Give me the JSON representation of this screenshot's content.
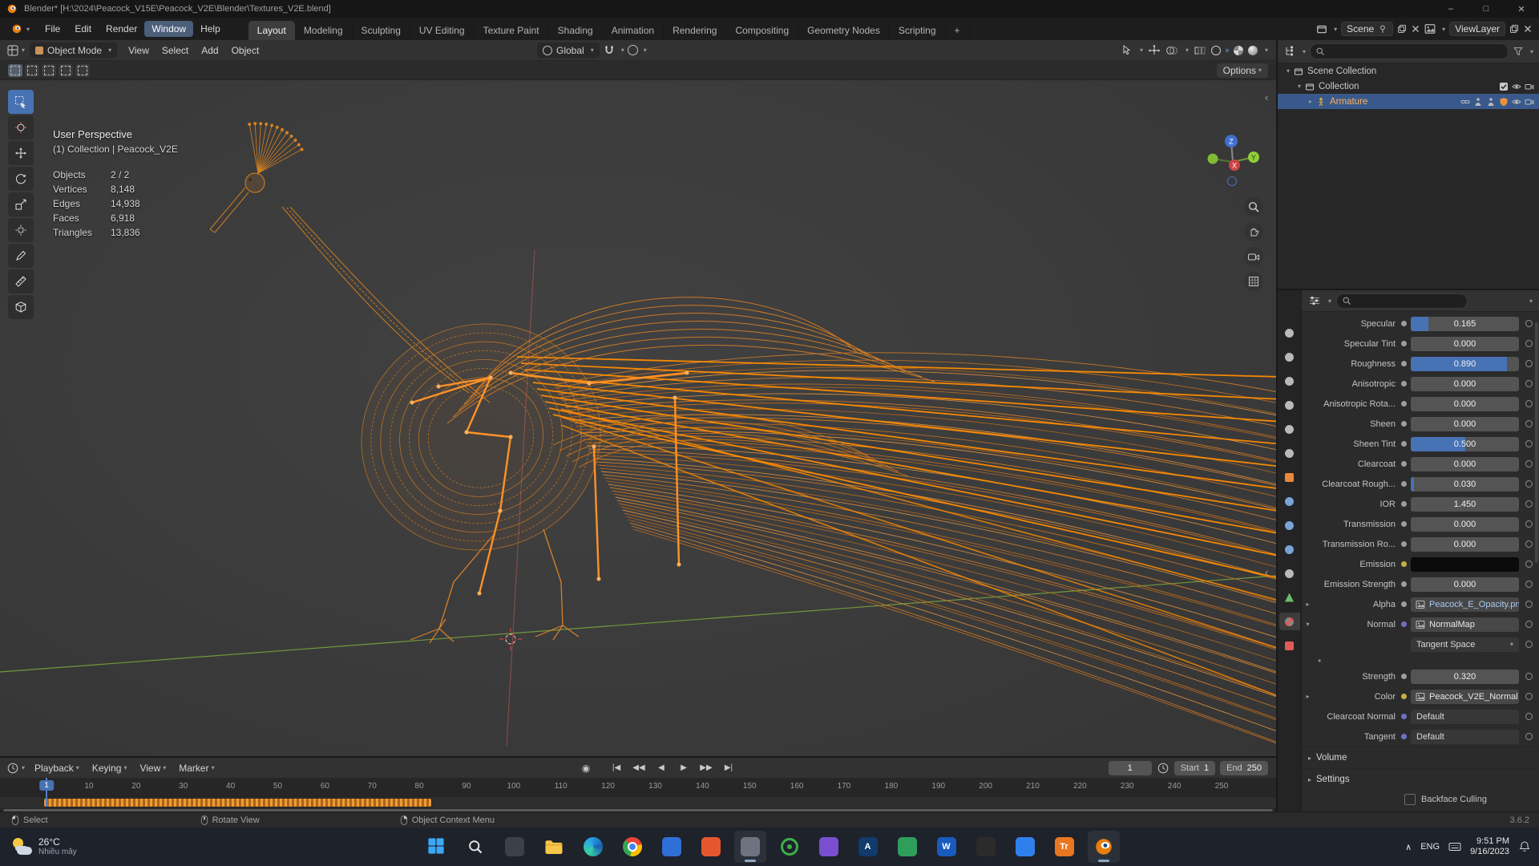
{
  "titlebar": {
    "title": "Blender* [H:\\2024\\Peacock_V15E\\Peacock_V2E\\Blender\\Textures_V2E.blend]"
  },
  "menubar": {
    "menus": [
      {
        "label": "File"
      },
      {
        "label": "Edit"
      },
      {
        "label": "Render"
      },
      {
        "label": "Window",
        "active": true
      },
      {
        "label": "Help"
      }
    ],
    "workspaces": [
      {
        "label": "Layout",
        "active": true
      },
      {
        "label": "Modeling"
      },
      {
        "label": "Sculpting"
      },
      {
        "label": "UV Editing"
      },
      {
        "label": "Texture Paint"
      },
      {
        "label": "Shading"
      },
      {
        "label": "Animation"
      },
      {
        "label": "Rendering"
      },
      {
        "label": "Compositing"
      },
      {
        "label": "Geometry Nodes"
      },
      {
        "label": "Scripting"
      },
      {
        "label": "+"
      }
    ],
    "scene": "Scene",
    "viewlayer": "ViewLayer"
  },
  "viewport": {
    "mode": "Object Mode",
    "menus": [
      "View",
      "Select",
      "Add",
      "Object"
    ],
    "orientation": "Global",
    "options": "Options",
    "tools": [
      "select-box",
      "cursor",
      "move",
      "rotate",
      "scale",
      "transform",
      "annotate",
      "measure",
      "add-cube"
    ],
    "side_buttons": [
      "zoom",
      "pan-hand",
      "camera-view",
      "toggle-orthographic"
    ],
    "axis": {
      "x": "X",
      "y": "Y",
      "z": "Z"
    },
    "overlay": {
      "perspective": "User Perspective",
      "breadcrumb": "(1) Collection | Peacock_V2E",
      "stats": [
        {
          "label": "Objects",
          "value": "2 / 2"
        },
        {
          "label": "Vertices",
          "value": "8,148"
        },
        {
          "label": "Edges",
          "value": "14,938"
        },
        {
          "label": "Faces",
          "value": "6,918"
        },
        {
          "label": "Triangles",
          "value": "13,836"
        }
      ]
    },
    "wire_color": "#e08428",
    "bone_color": "#ff9226"
  },
  "outliner": {
    "rows": [
      {
        "label": "Scene Collection",
        "depth": 0,
        "icon": "boxicon",
        "expander": "▾",
        "right": []
      },
      {
        "label": "Collection",
        "depth": 1,
        "icon": "boxicon",
        "expander": "▾",
        "right": [
          "checkbox",
          "eye",
          "camera-s"
        ]
      },
      {
        "label": "Armature",
        "depth": 2,
        "icon": "armature",
        "expander": "▸",
        "selected": true,
        "right": [
          "link",
          "person",
          "person",
          "shield",
          "eye",
          "camera-s"
        ]
      }
    ]
  },
  "properties": {
    "tabs": [
      "tool",
      "render",
      "output",
      "view-layer",
      "scene",
      "world",
      "object",
      "modifiers",
      "particles",
      "physics",
      "constraints",
      "data",
      "material",
      "texture"
    ],
    "active_tab": "material",
    "rows": [
      {
        "label": "Specular",
        "value": "0.165",
        "fill": 0.165,
        "socket": "#9d9d9d"
      },
      {
        "label": "Specular Tint",
        "value": "0.000",
        "fill": 0,
        "socket": "#9d9d9d"
      },
      {
        "label": "Roughness",
        "value": "0.890",
        "fill": 0.89,
        "socket": "#9d9d9d"
      },
      {
        "label": "Anisotropic",
        "value": "0.000",
        "fill": 0,
        "socket": "#9d9d9d"
      },
      {
        "label": "Anisotropic Rota...",
        "value": "0.000",
        "fill": 0,
        "socket": "#9d9d9d"
      },
      {
        "label": "Sheen",
        "value": "0.000",
        "fill": 0,
        "socket": "#9d9d9d"
      },
      {
        "label": "Sheen Tint",
        "value": "0.500",
        "fill": 0.5,
        "socket": "#9d9d9d"
      },
      {
        "label": "Clearcoat",
        "value": "0.000",
        "fill": 0,
        "socket": "#9d9d9d"
      },
      {
        "label": "Clearcoat Rough...",
        "value": "0.030",
        "fill": 0.03,
        "socket": "#9d9d9d"
      },
      {
        "label": "IOR",
        "value": "1.450",
        "fill": 0,
        "socket": "#9d9d9d"
      },
      {
        "label": "Transmission",
        "value": "0.000",
        "fill": 0,
        "socket": "#9d9d9d"
      },
      {
        "label": "Transmission Ro...",
        "value": "0.000",
        "fill": 0,
        "socket": "#9d9d9d"
      },
      {
        "label": "Emission",
        "value": "",
        "type": "color",
        "socket": "#c9b043",
        "swatch": "#0b0b0b"
      },
      {
        "label": "Emission Strength",
        "value": "0.000",
        "fill": 0,
        "socket": "#9d9d9d"
      },
      {
        "label": "Alpha",
        "value": "Peacock_E_Opacity.png",
        "type": "tex",
        "expand": "▸",
        "socket": "#9d9d9d",
        "value_color": "#a9c9f2"
      },
      {
        "label": "Normal",
        "value": "NormalMap",
        "type": "tex",
        "expand": "▾",
        "socket": "#7070c9",
        "value_color": "#e8e8e8"
      }
    ],
    "normal_space": "Tangent Space",
    "sub_rows": [
      {
        "label": "Strength",
        "value": "0.320",
        "fill": 0,
        "socket": "#9d9d9d"
      },
      {
        "label": "Color",
        "value": "Peacock_V2E_Normal",
        "type": "tex",
        "expand": "▸",
        "socket": "#c9b043",
        "value_color": "#e8e8e8"
      },
      {
        "label": "Clearcoat Normal",
        "value": "Default",
        "type": "menu",
        "socket": "#7070c9"
      },
      {
        "label": "Tangent",
        "value": "Default",
        "type": "menu",
        "socket": "#7070c9"
      }
    ],
    "sections": [
      {
        "label": "Volume"
      },
      {
        "label": "Settings"
      }
    ],
    "backface": "Backface Culling",
    "accent_blue": "#4772b3"
  },
  "timeline": {
    "menus": [
      "Playback",
      "Keying",
      "View",
      "Marker"
    ],
    "transport": [
      "jump-to-start",
      "previous-keyframe",
      "play-reverse",
      "play",
      "next-keyframe",
      "jump-to-end"
    ],
    "frame": "1",
    "start_label": "Start",
    "start": "1",
    "end_label": "End",
    "end": "250",
    "first_frame": 1,
    "last_frame": 250,
    "ticks": [
      10,
      20,
      30,
      40,
      50,
      60,
      70,
      80,
      90,
      100,
      110,
      120,
      130,
      140,
      150,
      160,
      170,
      180,
      190,
      200,
      210,
      220,
      230,
      240,
      250
    ],
    "keyframes_from": 1,
    "keyframes_to": 82,
    "key_color": "#f09a33"
  },
  "statusbar": {
    "hints": [
      {
        "button": "mouse-l",
        "label": "Select"
      },
      {
        "button": "mouse-m",
        "label": "Rotate View"
      },
      {
        "button": "mouse-r",
        "label": "Object Context Menu"
      }
    ],
    "version": "3.6.2"
  },
  "taskbar": {
    "weather": {
      "temp": "26°C",
      "desc": "Nhiều mây"
    },
    "apps": [
      {
        "name": "start"
      },
      {
        "name": "search"
      },
      {
        "name": "app-dark",
        "color": "#3c4048"
      },
      {
        "name": "file-explorer"
      },
      {
        "name": "edge"
      },
      {
        "name": "chrome"
      },
      {
        "name": "app-blue",
        "color": "#2f6fd6"
      },
      {
        "name": "app-red",
        "color": "#e4572e"
      },
      {
        "name": "app-gray",
        "color": "#6d7480",
        "open": true
      },
      {
        "name": "app-green-ring",
        "color": "#3fae4a"
      },
      {
        "name": "app-purple",
        "color": "#7a4fd0"
      },
      {
        "name": "app-navy",
        "color": "#123a6b",
        "letter": "A"
      },
      {
        "name": "app-green",
        "color": "#2f9e5b"
      },
      {
        "name": "word",
        "color": "#185abd",
        "letter": "W"
      },
      {
        "name": "app-black",
        "color": "#2b2b2b"
      },
      {
        "name": "app-teal",
        "color": "#2f80ed"
      },
      {
        "name": "app-orange",
        "color": "#e87722",
        "letter": "Tr"
      },
      {
        "name": "blender",
        "open": true
      }
    ],
    "tray": {
      "lang": "ENG",
      "time": "9:51 PM",
      "date": "9/16/2023"
    }
  }
}
